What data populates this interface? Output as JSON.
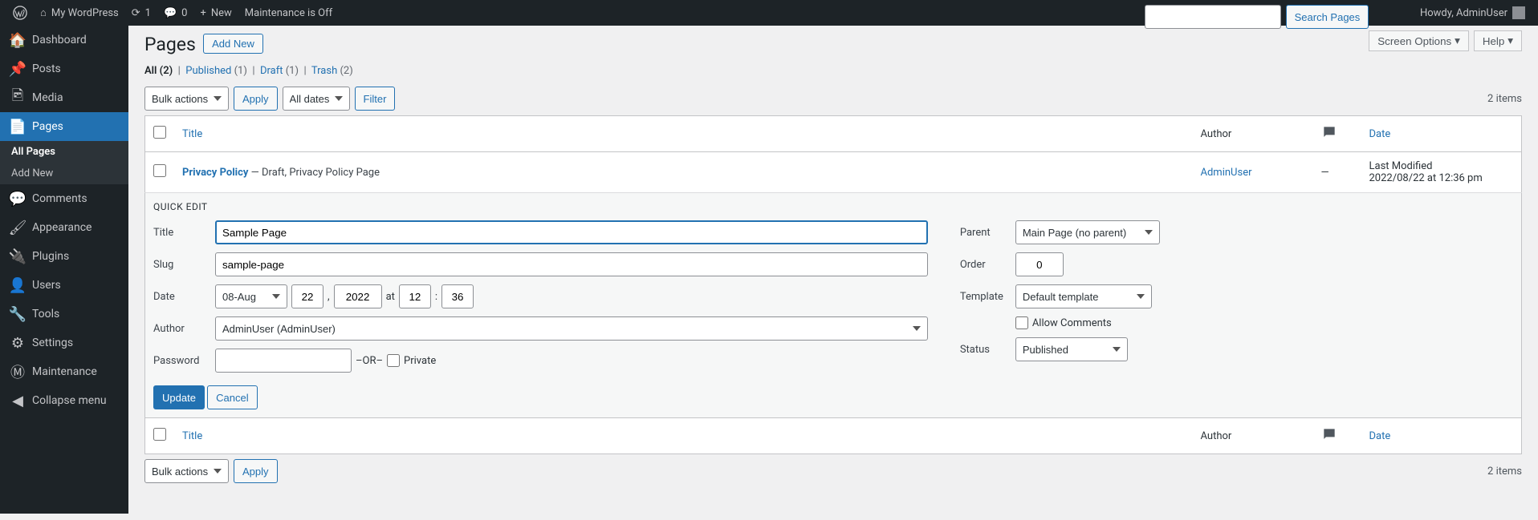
{
  "adminbar": {
    "site_name": "My WordPress",
    "updates": "1",
    "comments": "0",
    "new": "New",
    "maintenance": "Maintenance is Off",
    "howdy": "Howdy, AdminUser"
  },
  "sidebar": {
    "items": [
      {
        "label": "Dashboard",
        "icon": "⌂"
      },
      {
        "label": "Posts",
        "icon": "✎"
      },
      {
        "label": "Media",
        "icon": "🖾"
      },
      {
        "label": "Pages",
        "icon": "▤",
        "current": true
      },
      {
        "label": "Comments",
        "icon": "💬"
      },
      {
        "label": "Appearance",
        "icon": "✦"
      },
      {
        "label": "Plugins",
        "icon": "🔌"
      },
      {
        "label": "Users",
        "icon": "👤"
      },
      {
        "label": "Tools",
        "icon": "🔧"
      },
      {
        "label": "Settings",
        "icon": "⚙"
      },
      {
        "label": "Maintenance",
        "icon": "M"
      }
    ],
    "submenu": [
      "All Pages",
      "Add New"
    ],
    "collapse": "Collapse menu"
  },
  "header": {
    "title": "Pages",
    "add_new": "Add New",
    "screen_options": "Screen Options",
    "help": "Help"
  },
  "filters": {
    "all": "All",
    "all_count": "(2)",
    "published": "Published",
    "published_count": "(1)",
    "draft": "Draft",
    "draft_count": "(1)",
    "trash": "Trash",
    "trash_count": "(2)"
  },
  "search": {
    "button": "Search Pages"
  },
  "tablenav": {
    "bulk": "Bulk actions",
    "apply": "Apply",
    "dates": "All dates",
    "filter": "Filter",
    "count": "2 items"
  },
  "columns": {
    "title": "Title",
    "author": "Author",
    "date": "Date"
  },
  "row1": {
    "title": "Privacy Policy",
    "state": " — Draft, Privacy Policy Page",
    "author": "AdminUser",
    "comments": "—",
    "date_label": "Last Modified",
    "date_value": "2022/08/22 at 12:36 pm"
  },
  "quick_edit": {
    "legend": "QUICK EDIT",
    "title_label": "Title",
    "title_value": "Sample Page",
    "slug_label": "Slug",
    "slug_value": "sample-page",
    "date_label": "Date",
    "month": "08-Aug",
    "day": "22",
    "year": "2022",
    "at": "at",
    "hour": "12",
    "minute": "36",
    "author_label": "Author",
    "author_value": "AdminUser (AdminUser)",
    "password_label": "Password",
    "or": "–OR–",
    "private": "Private",
    "parent_label": "Parent",
    "parent_value": "Main Page (no parent)",
    "order_label": "Order",
    "order_value": "0",
    "template_label": "Template",
    "template_value": "Default template",
    "allow_comments": "Allow Comments",
    "status_label": "Status",
    "status_value": "Published",
    "update": "Update",
    "cancel": "Cancel"
  }
}
